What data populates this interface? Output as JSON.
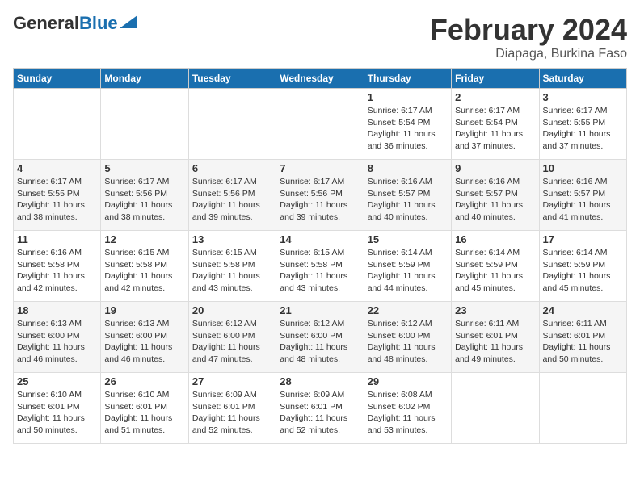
{
  "header": {
    "logo_general": "General",
    "logo_blue": "Blue",
    "title": "February 2024",
    "location": "Diapaga, Burkina Faso"
  },
  "weekdays": [
    "Sunday",
    "Monday",
    "Tuesday",
    "Wednesday",
    "Thursday",
    "Friday",
    "Saturday"
  ],
  "weeks": [
    [
      {
        "day": "",
        "info": ""
      },
      {
        "day": "",
        "info": ""
      },
      {
        "day": "",
        "info": ""
      },
      {
        "day": "",
        "info": ""
      },
      {
        "day": "1",
        "info": "Sunrise: 6:17 AM\nSunset: 5:54 PM\nDaylight: 11 hours and 36 minutes."
      },
      {
        "day": "2",
        "info": "Sunrise: 6:17 AM\nSunset: 5:54 PM\nDaylight: 11 hours and 37 minutes."
      },
      {
        "day": "3",
        "info": "Sunrise: 6:17 AM\nSunset: 5:55 PM\nDaylight: 11 hours and 37 minutes."
      }
    ],
    [
      {
        "day": "4",
        "info": "Sunrise: 6:17 AM\nSunset: 5:55 PM\nDaylight: 11 hours and 38 minutes."
      },
      {
        "day": "5",
        "info": "Sunrise: 6:17 AM\nSunset: 5:56 PM\nDaylight: 11 hours and 38 minutes."
      },
      {
        "day": "6",
        "info": "Sunrise: 6:17 AM\nSunset: 5:56 PM\nDaylight: 11 hours and 39 minutes."
      },
      {
        "day": "7",
        "info": "Sunrise: 6:17 AM\nSunset: 5:56 PM\nDaylight: 11 hours and 39 minutes."
      },
      {
        "day": "8",
        "info": "Sunrise: 6:16 AM\nSunset: 5:57 PM\nDaylight: 11 hours and 40 minutes."
      },
      {
        "day": "9",
        "info": "Sunrise: 6:16 AM\nSunset: 5:57 PM\nDaylight: 11 hours and 40 minutes."
      },
      {
        "day": "10",
        "info": "Sunrise: 6:16 AM\nSunset: 5:57 PM\nDaylight: 11 hours and 41 minutes."
      }
    ],
    [
      {
        "day": "11",
        "info": "Sunrise: 6:16 AM\nSunset: 5:58 PM\nDaylight: 11 hours and 42 minutes."
      },
      {
        "day": "12",
        "info": "Sunrise: 6:15 AM\nSunset: 5:58 PM\nDaylight: 11 hours and 42 minutes."
      },
      {
        "day": "13",
        "info": "Sunrise: 6:15 AM\nSunset: 5:58 PM\nDaylight: 11 hours and 43 minutes."
      },
      {
        "day": "14",
        "info": "Sunrise: 6:15 AM\nSunset: 5:58 PM\nDaylight: 11 hours and 43 minutes."
      },
      {
        "day": "15",
        "info": "Sunrise: 6:14 AM\nSunset: 5:59 PM\nDaylight: 11 hours and 44 minutes."
      },
      {
        "day": "16",
        "info": "Sunrise: 6:14 AM\nSunset: 5:59 PM\nDaylight: 11 hours and 45 minutes."
      },
      {
        "day": "17",
        "info": "Sunrise: 6:14 AM\nSunset: 5:59 PM\nDaylight: 11 hours and 45 minutes."
      }
    ],
    [
      {
        "day": "18",
        "info": "Sunrise: 6:13 AM\nSunset: 6:00 PM\nDaylight: 11 hours and 46 minutes."
      },
      {
        "day": "19",
        "info": "Sunrise: 6:13 AM\nSunset: 6:00 PM\nDaylight: 11 hours and 46 minutes."
      },
      {
        "day": "20",
        "info": "Sunrise: 6:12 AM\nSunset: 6:00 PM\nDaylight: 11 hours and 47 minutes."
      },
      {
        "day": "21",
        "info": "Sunrise: 6:12 AM\nSunset: 6:00 PM\nDaylight: 11 hours and 48 minutes."
      },
      {
        "day": "22",
        "info": "Sunrise: 6:12 AM\nSunset: 6:00 PM\nDaylight: 11 hours and 48 minutes."
      },
      {
        "day": "23",
        "info": "Sunrise: 6:11 AM\nSunset: 6:01 PM\nDaylight: 11 hours and 49 minutes."
      },
      {
        "day": "24",
        "info": "Sunrise: 6:11 AM\nSunset: 6:01 PM\nDaylight: 11 hours and 50 minutes."
      }
    ],
    [
      {
        "day": "25",
        "info": "Sunrise: 6:10 AM\nSunset: 6:01 PM\nDaylight: 11 hours and 50 minutes."
      },
      {
        "day": "26",
        "info": "Sunrise: 6:10 AM\nSunset: 6:01 PM\nDaylight: 11 hours and 51 minutes."
      },
      {
        "day": "27",
        "info": "Sunrise: 6:09 AM\nSunset: 6:01 PM\nDaylight: 11 hours and 52 minutes."
      },
      {
        "day": "28",
        "info": "Sunrise: 6:09 AM\nSunset: 6:01 PM\nDaylight: 11 hours and 52 minutes."
      },
      {
        "day": "29",
        "info": "Sunrise: 6:08 AM\nSunset: 6:02 PM\nDaylight: 11 hours and 53 minutes."
      },
      {
        "day": "",
        "info": ""
      },
      {
        "day": "",
        "info": ""
      }
    ]
  ]
}
